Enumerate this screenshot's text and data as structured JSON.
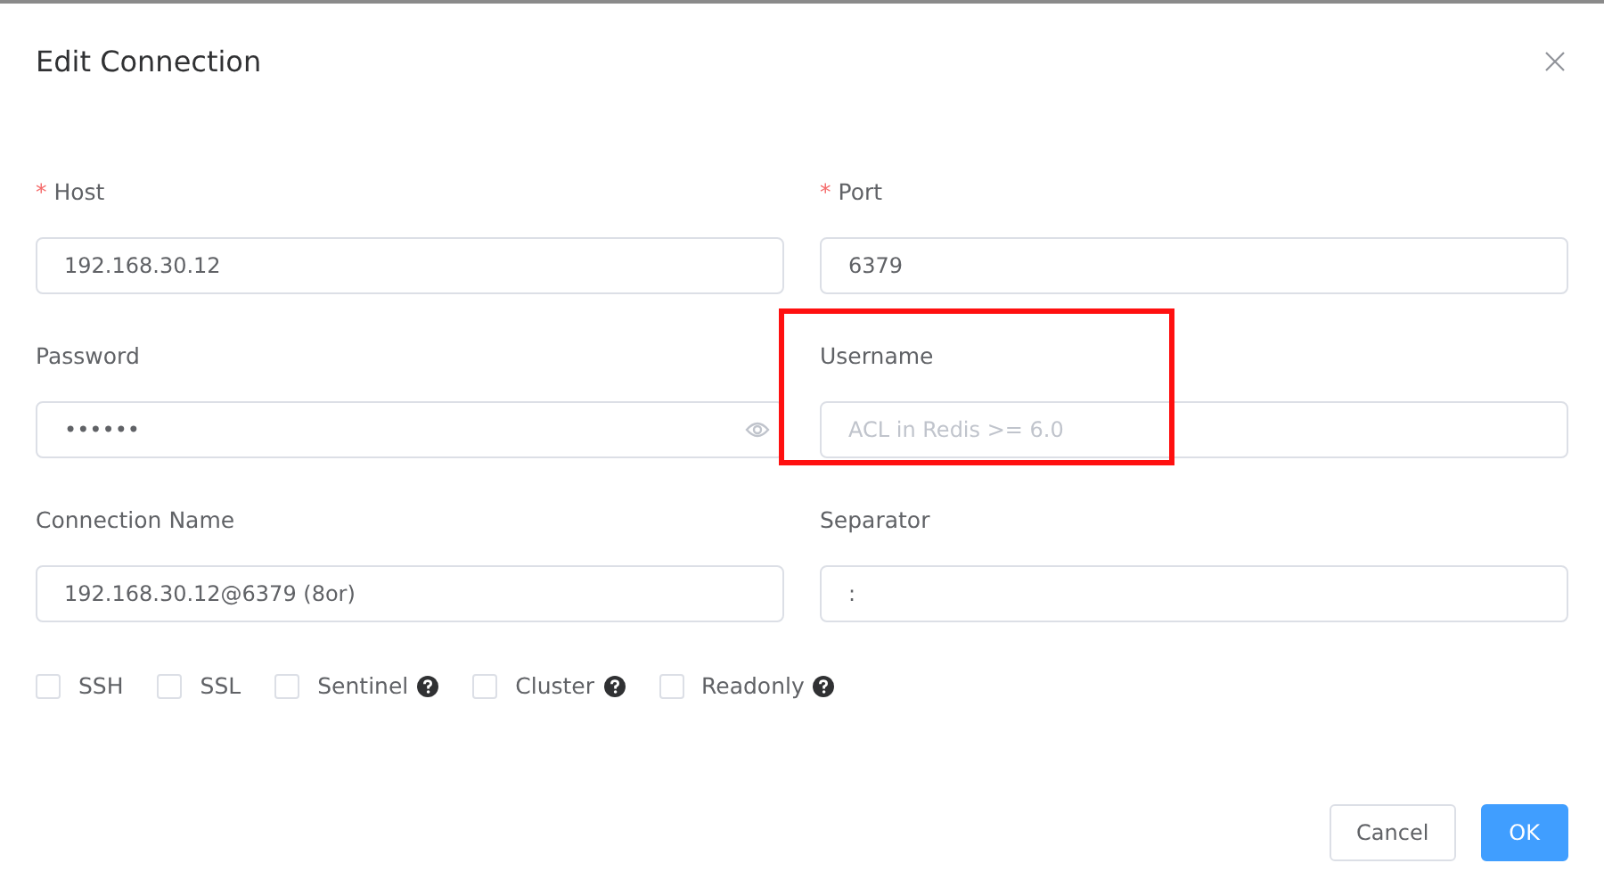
{
  "dialog": {
    "title": "Edit Connection"
  },
  "fields": [
    {
      "required_mark": "*",
      "label": "Host",
      "value": "192.168.30.12",
      "highlighted": false,
      "kind": "text"
    },
    {
      "required_mark": "*",
      "label": "Port",
      "value": "6379",
      "highlighted": false,
      "kind": "text"
    },
    {
      "label": "Password",
      "value": "••••••",
      "highlighted": false,
      "kind": "password"
    },
    {
      "label": "Username",
      "placeholder": "ACL in Redis >= 6.0",
      "highlighted": true,
      "kind": "text"
    },
    {
      "label": "Connection Name",
      "value": "192.168.30.12@6379 (8or)",
      "highlighted": false,
      "kind": "text"
    },
    {
      "label": "Separator",
      "value": ":",
      "highlighted": false,
      "kind": "text"
    }
  ],
  "options": [
    {
      "label": "SSH",
      "checked": false,
      "help": false
    },
    {
      "label": "SSL",
      "checked": false,
      "help": false
    },
    {
      "label": "Sentinel",
      "checked": false,
      "help": true
    },
    {
      "label": "Cluster",
      "checked": false,
      "help": true
    },
    {
      "label": "Readonly",
      "checked": false,
      "help": true
    }
  ],
  "buttons": [
    {
      "label": "Cancel",
      "kind": "secondary"
    },
    {
      "label": "OK",
      "kind": "primary"
    }
  ]
}
